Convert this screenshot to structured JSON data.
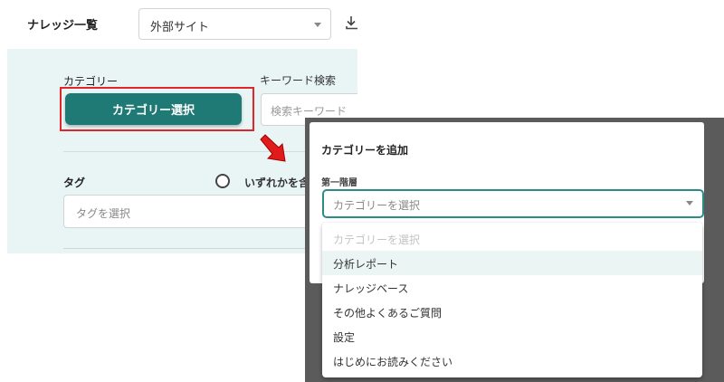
{
  "header": {
    "title": "ナレッジ一覧",
    "site_select_value": "外部サイト"
  },
  "filters": {
    "category_label": "カテゴリー",
    "category_button": "カテゴリー選択",
    "keyword_label": "キーワード検索",
    "keyword_placeholder": "検索キーワード",
    "tag_label": "タグ",
    "tag_match_label": "いずれかを含",
    "tag_placeholder": "タグを選択"
  },
  "dialog": {
    "title": "カテゴリーを追加",
    "level_label": "第一階層",
    "select_placeholder": "カテゴリーを選択",
    "options": [
      "カテゴリーを選択",
      "分析レポート",
      "ナレッジベース",
      "その他よくあるご質問",
      "設定",
      "はじめにお読みください"
    ]
  },
  "colors": {
    "accent_teal": "#1f7a75",
    "highlight_red": "#e0262a",
    "panel_bg": "#e8f5f4"
  }
}
